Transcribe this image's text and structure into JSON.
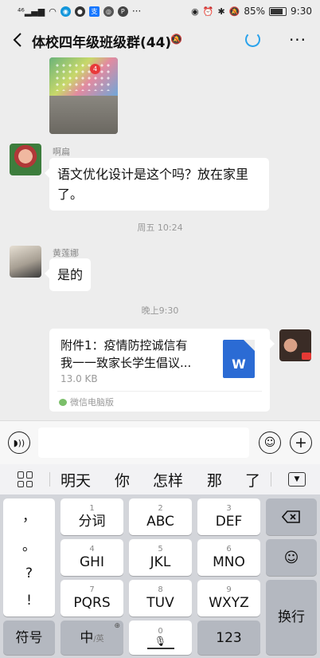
{
  "status_bar": {
    "left_icons": [
      "signal-icon",
      "wifi-icon",
      "qq-icon",
      "message-icon",
      "alipay-icon",
      "app-icon",
      "p-icon"
    ],
    "more_label": "···",
    "right_icons": [
      "eye-icon",
      "alarm-icon",
      "bluetooth-icon",
      "silent-icon"
    ],
    "battery_percent": "85%",
    "battery_level": 0.85,
    "time": "9:30"
  },
  "header": {
    "title": "体校四年级班级群(44)",
    "more_label": "···"
  },
  "messages": {
    "msg1": {
      "sender": "啊扁",
      "text": "语文优化设计是这个吗？放在家里了。"
    },
    "time1": "周五 10:24",
    "msg2": {
      "sender": "黄莲娜",
      "text": "是的"
    },
    "time2": "晚上9:30",
    "file": {
      "name_line1": "附件1：疫情防控诚信有",
      "name_line2": "我一一致家长学生倡议...",
      "size": "13.0 KB",
      "icon_letter": "W",
      "source": "微信电脑版"
    }
  },
  "input_bar": {
    "value": "",
    "plus_label": "+"
  },
  "candidates": {
    "words": [
      "明天",
      "你",
      "怎样",
      "那",
      "了"
    ]
  },
  "keyboard": {
    "punctuation": [
      "，",
      "。",
      "?",
      "!"
    ],
    "rows": [
      [
        {
          "num": "1",
          "main": "分词"
        },
        {
          "num": "2",
          "main": "ABC"
        },
        {
          "num": "3",
          "main": "DEF"
        }
      ],
      [
        {
          "num": "4",
          "main": "GHI"
        },
        {
          "num": "5",
          "main": "JKL"
        },
        {
          "num": "6",
          "main": "MNO"
        }
      ],
      [
        {
          "num": "7",
          "main": "PQRS"
        },
        {
          "num": "8",
          "main": "TUV"
        },
        {
          "num": "9",
          "main": "WXYZ"
        }
      ]
    ],
    "enter_label": "换行",
    "symbol_label": "符号",
    "lang_main": "中",
    "lang_sub": "/英",
    "space_num": "0",
    "num_label": "123"
  },
  "colors": {
    "background": "#ededed",
    "bubble": "#ffffff",
    "word_blue": "#2b6bd4",
    "loading_blue": "#2aa3ec",
    "keyboard_bg": "#d3d5da"
  }
}
